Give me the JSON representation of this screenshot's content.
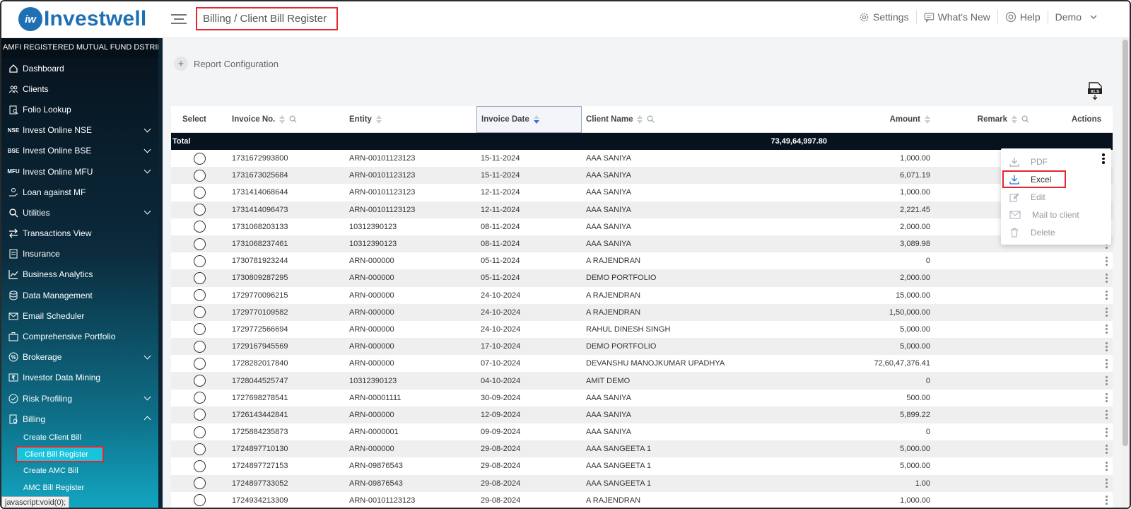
{
  "brand": {
    "logo_mark": "iw",
    "name": "Investwell"
  },
  "breadcrumb": "Billing / Client Bill Register",
  "topnav": {
    "settings": "Settings",
    "whats_new": "What's New",
    "help": "Help",
    "user": "Demo"
  },
  "sidebar": {
    "header": "AMFI REGISTERED MUTUAL FUND DSTRIBUTOR",
    "items": [
      {
        "label": "Dashboard",
        "icon": "home-icon"
      },
      {
        "label": "Clients",
        "icon": "users-icon"
      },
      {
        "label": "Folio Lookup",
        "icon": "folio-icon"
      },
      {
        "label": "Invest Online NSE",
        "icon": "NSE",
        "expandable": true
      },
      {
        "label": "Invest Online BSE",
        "icon": "BSE",
        "expandable": true
      },
      {
        "label": "Invest Online MFU",
        "icon": "MFU",
        "expandable": true
      },
      {
        "label": "Loan against MF",
        "icon": "loan-icon"
      },
      {
        "label": "Utilities",
        "icon": "utilities-icon",
        "expandable": true
      },
      {
        "label": "Transactions View",
        "icon": "transfer-icon"
      },
      {
        "label": "Insurance",
        "icon": "insurance-icon"
      },
      {
        "label": "Business Analytics",
        "icon": "analytics-icon"
      },
      {
        "label": "Data Management",
        "icon": "data-icon"
      },
      {
        "label": "Email Scheduler",
        "icon": "email-icon"
      },
      {
        "label": "Comprehensive Portfolio",
        "icon": "portfolio-icon"
      },
      {
        "label": "Brokerage",
        "icon": "brokerage-icon",
        "expandable": true
      },
      {
        "label": "Investor Data Mining",
        "icon": "rupee-icon"
      },
      {
        "label": "Risk Profiling",
        "icon": "risk-icon",
        "expandable": true
      },
      {
        "label": "Billing",
        "icon": "billing-icon",
        "expandable": true,
        "expanded": true
      }
    ],
    "billing_sub": [
      "Create Client Bill",
      "Client Bill Register",
      "Create AMC Bill",
      "AMC Bill Register"
    ]
  },
  "status_tooltip": "javascript:void(0);",
  "report_config": "Report Configuration",
  "table": {
    "headers": {
      "select": "Select",
      "invoice": "Invoice No.",
      "entity": "Entity",
      "date": "Invoice Date",
      "client": "Client Name",
      "amount": "Amount",
      "remark": "Remark",
      "actions": "Actions"
    },
    "total_label": "Total",
    "total_amount": "73,49,64,997.80",
    "rows": [
      [
        "1731672993800",
        "ARN-00101123123",
        "15-11-2024",
        "AAA SANIYA",
        "1,000.00"
      ],
      [
        "1731673025684",
        "ARN-00101123123",
        "15-11-2024",
        "AAA SANIYA",
        "6,071.19"
      ],
      [
        "1731414068644",
        "ARN-00101123123",
        "12-11-2024",
        "AAA SANIYA",
        "1,000.00"
      ],
      [
        "1731414096473",
        "ARN-00101123123",
        "12-11-2024",
        "AAA SANIYA",
        "2,221.45"
      ],
      [
        "1731068203133",
        "10312390123",
        "08-11-2024",
        "AAA SANIYA",
        "2,000.00"
      ],
      [
        "1731068237461",
        "10312390123",
        "08-11-2024",
        "AAA SANIYA",
        "3,089.98"
      ],
      [
        "1730781923244",
        "ARN-000000",
        "05-11-2024",
        "A RAJENDRAN",
        "0"
      ],
      [
        "1730809287295",
        "ARN-000000",
        "05-11-2024",
        "DEMO PORTFOLIO",
        "2,000.00"
      ],
      [
        "1729770096215",
        "ARN-000000",
        "24-10-2024",
        "A RAJENDRAN",
        "15,000.00"
      ],
      [
        "1729770109582",
        "ARN-000000",
        "24-10-2024",
        "A RAJENDRAN",
        "1,50,000.00"
      ],
      [
        "1729772566694",
        "ARN-000000",
        "24-10-2024",
        "RAHUL DINESH SINGH",
        "5,000.00"
      ],
      [
        "1729167945569",
        "ARN-000000",
        "17-10-2024",
        "DEMO PORTFOLIO",
        "5,000.00"
      ],
      [
        "1728282017840",
        "ARN-000000",
        "07-10-2024",
        "DEVANSHU MANOJKUMAR UPADHYA",
        "72,60,47,376.41"
      ],
      [
        "1728044525747",
        "10312390123",
        "04-10-2024",
        "AMIT DEMO",
        "0"
      ],
      [
        "1727698278541",
        "ARN-00001111",
        "30-09-2024",
        "AAA SANIYA",
        "500.00"
      ],
      [
        "1726143442841",
        "ARN-000000",
        "12-09-2024",
        "AAA SANIYA",
        "5,899.22"
      ],
      [
        "1725884235873",
        "ARN-0000001",
        "09-09-2024",
        "AAA SANIYA",
        "0"
      ],
      [
        "1724897710130",
        "ARN-000000",
        "29-08-2024",
        "AAA SANGEETA 1",
        "5,000.00"
      ],
      [
        "1724897727153",
        "ARN-09876543",
        "29-08-2024",
        "AAA SANGEETA 1",
        "5,000.00"
      ],
      [
        "1724897733052",
        "ARN-09876543",
        "29-08-2024",
        "AAA SANGEETA 1",
        "1.00"
      ],
      [
        "1724934213309",
        "ARN-00101123123",
        "29-08-2024",
        "A RAJENDRAN",
        "1,000.00"
      ]
    ]
  },
  "row_menu": {
    "items": [
      {
        "label": "PDF",
        "icon": "download-icon"
      },
      {
        "label": "Excel",
        "icon": "download-icon",
        "active": true
      },
      {
        "label": "Edit",
        "icon": "edit-icon"
      },
      {
        "label": "Mail to client",
        "icon": "mail-icon"
      },
      {
        "label": "Delete",
        "icon": "trash-icon"
      }
    ]
  },
  "colors": {
    "brand": "#1f6fb5",
    "highlight": "#e3262f",
    "active_sub": "#18c3dc",
    "total_row": "#06131f"
  }
}
